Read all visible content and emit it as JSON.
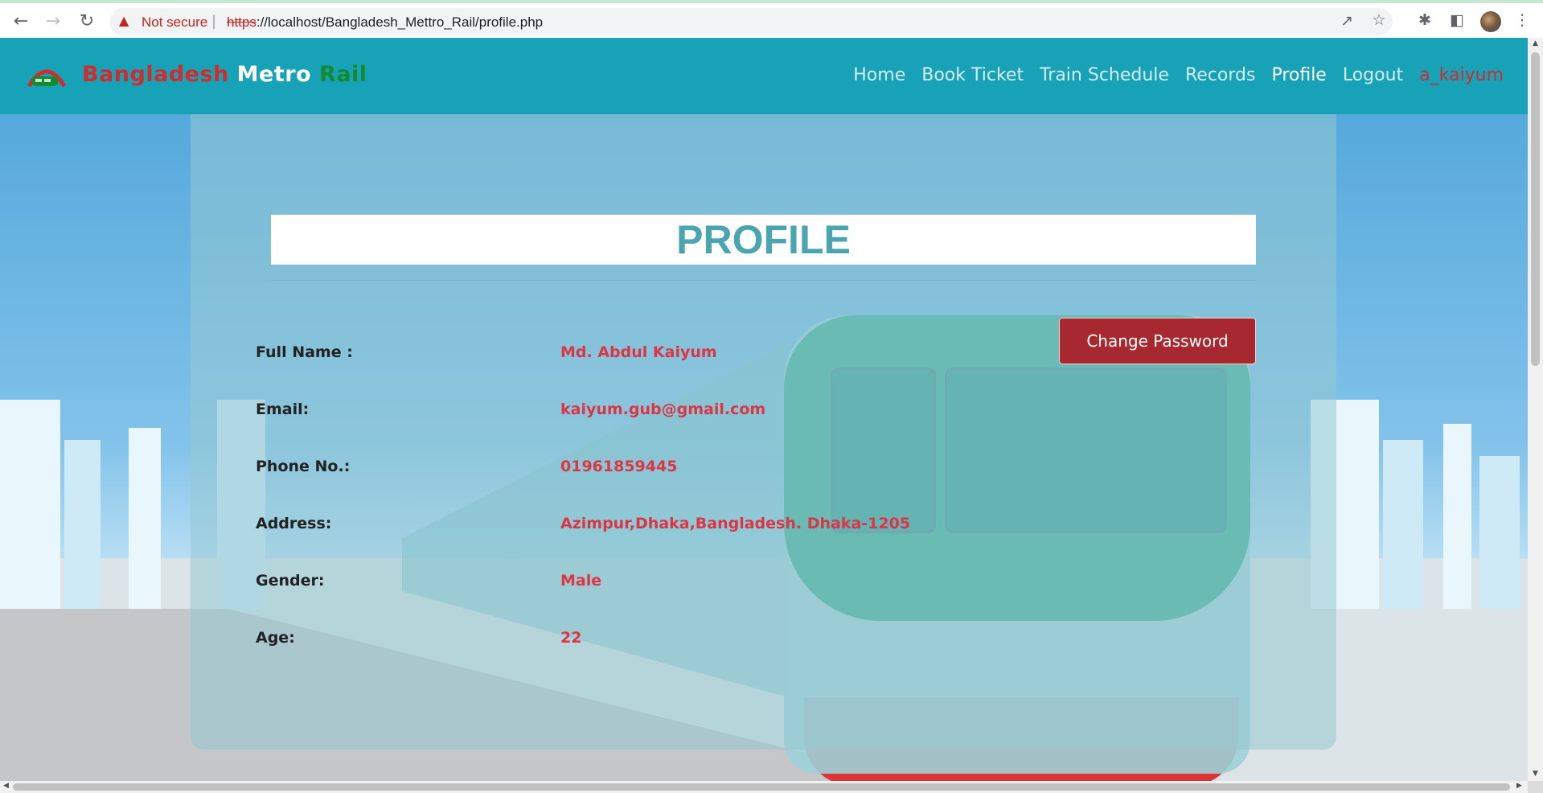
{
  "browser": {
    "security_label": "Not secure",
    "separator": "|",
    "url_scheme": "https",
    "url_rest": "://localhost/Bangladesh_Mettro_Rail/profile.php",
    "icons": [
      "back-icon",
      "forward-icon",
      "reload-icon",
      "warning-icon",
      "share-icon",
      "star-icon",
      "extensions-icon",
      "sidepanel-icon",
      "menu-icon"
    ]
  },
  "navbar": {
    "brand_word1": "Bangladesh",
    "brand_word2": "Metro",
    "brand_word3": "Rail",
    "links": {
      "home": "Home",
      "book_ticket": "Book Ticket",
      "train_schedule": "Train Schedule",
      "records": "Records",
      "profile": "Profile",
      "logout": "Logout",
      "user": "a_kaiyum"
    }
  },
  "profile": {
    "title": "PROFILE",
    "change_password_label": "Change Password",
    "fields": [
      {
        "label": "Full Name :",
        "value": "Md. Abdul Kaiyum"
      },
      {
        "label": "Email:",
        "value": "kaiyum.gub@gmail.com"
      },
      {
        "label": "Phone No.:",
        "value": "01961859445"
      },
      {
        "label": "Address:",
        "value": "Azimpur,Dhaka,Bangladesh. Dhaka-1205"
      },
      {
        "label": "Gender:",
        "value": "Male"
      },
      {
        "label": "Age:",
        "value": "22"
      }
    ]
  },
  "colors": {
    "navbar": "#17a2b8",
    "brand_red": "#d22b2b",
    "brand_green": "#138a2e",
    "value_red": "#dc3545",
    "button": "#a8282f",
    "title": "#4aa5b0"
  }
}
